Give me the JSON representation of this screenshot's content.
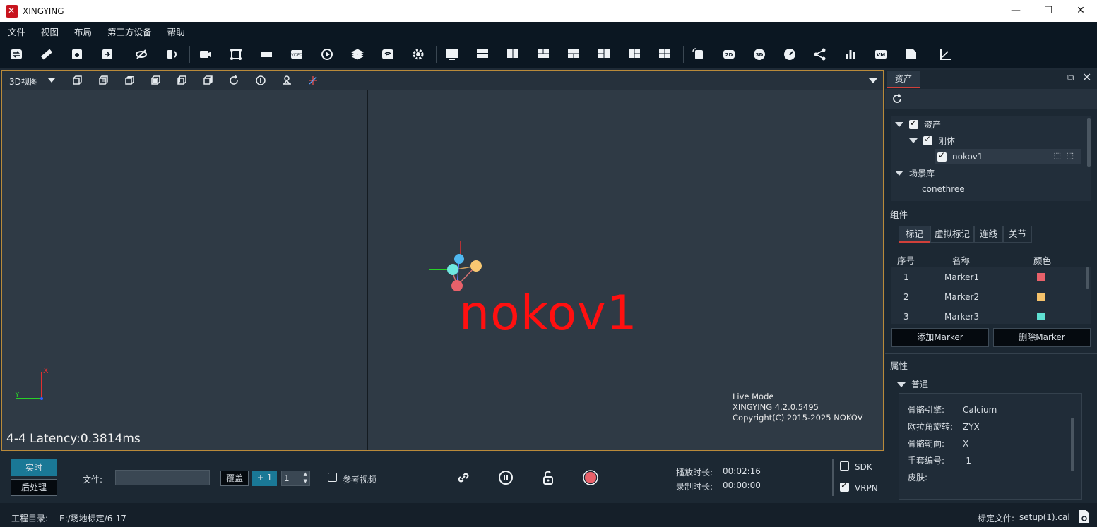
{
  "app": {
    "title": "XINGYING"
  },
  "window_controls": {
    "minimize": "—",
    "maximize": "☐",
    "close": "✕"
  },
  "menu": [
    "文件",
    "视图",
    "布局",
    "第三方设备",
    "帮助"
  ],
  "viewport": {
    "view_mode": "3D视图",
    "rigid_body_label": "nokov1",
    "latency": "4-4 Latency:0.3814ms",
    "axis_x": "X",
    "axis_y": "Y",
    "info": [
      "Live Mode",
      "XINGYING 4.2.0.5495",
      "Copyright(C) 2015-2025 NOKOV"
    ]
  },
  "bottom": {
    "realtime": "实时",
    "postprocess": "后处理",
    "file_label": "文件:",
    "file_value": "",
    "overwrite": "覆盖",
    "plus_one": "+ 1",
    "spin_value": "1",
    "ref_video": "参考视频",
    "play_duration_label": "播放时长:",
    "play_duration": "00:02:16",
    "record_duration_label": "录制时长:",
    "record_duration": "00:00:00",
    "sdk": "SDK",
    "vrpn": "VRPN"
  },
  "status": {
    "project_label": "工程目录:",
    "project_path": "E:/场地标定/6-17",
    "calib_label": "标定文件:",
    "calib_file": "setup(1).cal"
  },
  "assets_panel": {
    "tab": "资产",
    "tree": {
      "assets": "资产",
      "rigid": "刚体",
      "rigid_item": "nokov1",
      "scene_lib": "场景库",
      "scene_item": "conethree"
    },
    "components_title": "组件",
    "component_tabs": [
      "标记",
      "虚拟标记",
      "连线",
      "关节"
    ],
    "marker_headers": {
      "index": "序号",
      "name": "名称",
      "color": "颜色"
    },
    "markers": [
      {
        "index": "1",
        "name": "Marker1",
        "color": "#e8616a"
      },
      {
        "index": "2",
        "name": "Marker2",
        "color": "#f5c26b"
      },
      {
        "index": "3",
        "name": "Marker3",
        "color": "#5fe0d2"
      }
    ],
    "add_marker": "添加Marker",
    "delete_marker": "删除Marker",
    "props_title": "属性",
    "props_group": "普通",
    "props": [
      {
        "k": "骨骼引擎:",
        "v": "Calcium"
      },
      {
        "k": "欧拉角旋转:",
        "v": "ZYX"
      },
      {
        "k": "骨骼朝向:",
        "v": "X"
      },
      {
        "k": "手套编号:",
        "v": "-1"
      },
      {
        "k": "皮肤:",
        "v": ""
      }
    ]
  }
}
